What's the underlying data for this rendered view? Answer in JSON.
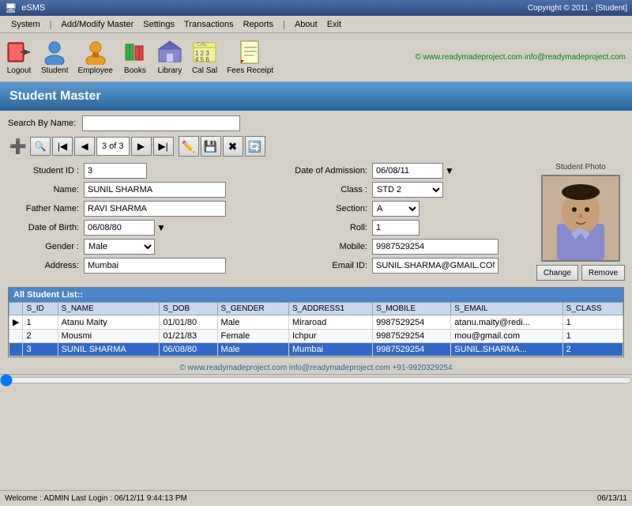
{
  "titlebar": {
    "app_name": "eSMS",
    "copyright": "Copyright © 2011 - [Student]"
  },
  "menubar": {
    "items": [
      {
        "label": "System",
        "id": "system"
      },
      {
        "label": "|",
        "id": "sep1"
      },
      {
        "label": "Add/Modify Master",
        "id": "add-modify"
      },
      {
        "label": "Settings",
        "id": "settings"
      },
      {
        "label": "Transactions",
        "id": "transactions"
      },
      {
        "label": "Reports",
        "id": "reports"
      },
      {
        "label": "|",
        "id": "sep2"
      },
      {
        "label": "About",
        "id": "about"
      },
      {
        "label": "Exit",
        "id": "exit"
      }
    ]
  },
  "toolbar": {
    "buttons": [
      {
        "label": "Logout",
        "icon": "🚪",
        "id": "logout"
      },
      {
        "label": "Student",
        "icon": "👤",
        "id": "student"
      },
      {
        "label": "Employee",
        "icon": "👷",
        "id": "employee"
      },
      {
        "label": "Books",
        "icon": "📚",
        "id": "books"
      },
      {
        "label": "Library",
        "icon": "🏛️",
        "id": "library"
      },
      {
        "label": "Cal Sal",
        "icon": "🧮",
        "id": "cal-sal"
      },
      {
        "label": "Fees Receipt",
        "icon": "🧾",
        "id": "fees-receipt"
      }
    ],
    "web_info": "© www.readymadeproject.com  info@readymadeproject.com"
  },
  "page_header": {
    "title": "Student Master"
  },
  "search": {
    "label": "Search By Name:",
    "placeholder": ""
  },
  "navigation": {
    "counter": "3 of 3"
  },
  "form": {
    "student_id_label": "Student ID :",
    "student_id_value": "3",
    "name_label": "Name:",
    "name_value": "SUNIL SHARMA",
    "father_name_label": "Father Name:",
    "father_name_value": "RAVI SHARMA",
    "dob_label": "Date of Birth:",
    "dob_value": "06/08/80",
    "gender_label": "Gender :",
    "gender_value": "Male",
    "address_label": "Address:",
    "address_value": "Mumbai",
    "date_of_admission_label": "Date of Admission:",
    "date_of_admission_value": "06/08/11",
    "class_label": "Class :",
    "class_value": "STD 2",
    "section_label": "Section:",
    "section_value": "A",
    "roll_label": "Roll:",
    "roll_value": "1",
    "mobile_label": "Mobile:",
    "mobile_value": "9987529254",
    "email_label": "Email ID:",
    "email_value": "SUNIL.SHARMA@GMAIL.COM",
    "photo_label": "Student Photo",
    "change_btn": "Change",
    "remove_btn": "Remove"
  },
  "student_list": {
    "header": "All Student List::",
    "columns": [
      "",
      "S_ID",
      "S_NAME",
      "S_DOB",
      "S_GENDER",
      "S_ADDRESS1",
      "S_MOBILE",
      "S_EMAIL",
      "S_CLASS"
    ],
    "rows": [
      {
        "indicator": "▶",
        "s_id": "1",
        "s_name": "Atanu Maity",
        "s_dob": "01/01/80",
        "s_gender": "Male",
        "s_address": "Miraroad",
        "s_mobile": "9987529254",
        "s_email": "atanu.maity@redi...",
        "s_class": "1",
        "selected": false
      },
      {
        "indicator": "",
        "s_id": "2",
        "s_name": "Mousmi",
        "s_dob": "01/21/83",
        "s_gender": "Female",
        "s_address": "Ichpur",
        "s_mobile": "9987529254",
        "s_email": "mou@gmail.com",
        "s_class": "1",
        "selected": false
      },
      {
        "indicator": "",
        "s_id": "3",
        "s_name": "SUNIL SHARMA",
        "s_dob": "06/08/80",
        "s_gender": "Male",
        "s_address": "Mumbai",
        "s_mobile": "9987529254",
        "s_email": "SUNIL.SHARMA...",
        "s_class": "2",
        "selected": true
      }
    ]
  },
  "footer": {
    "web_info": "© www.readymadeproject.com  info@readymadeproject.com  +91-9920329254",
    "status": "Welcome : ADMIN  Last Login : 06/12/11 9:44:13 PM",
    "date": "06/13/11"
  }
}
